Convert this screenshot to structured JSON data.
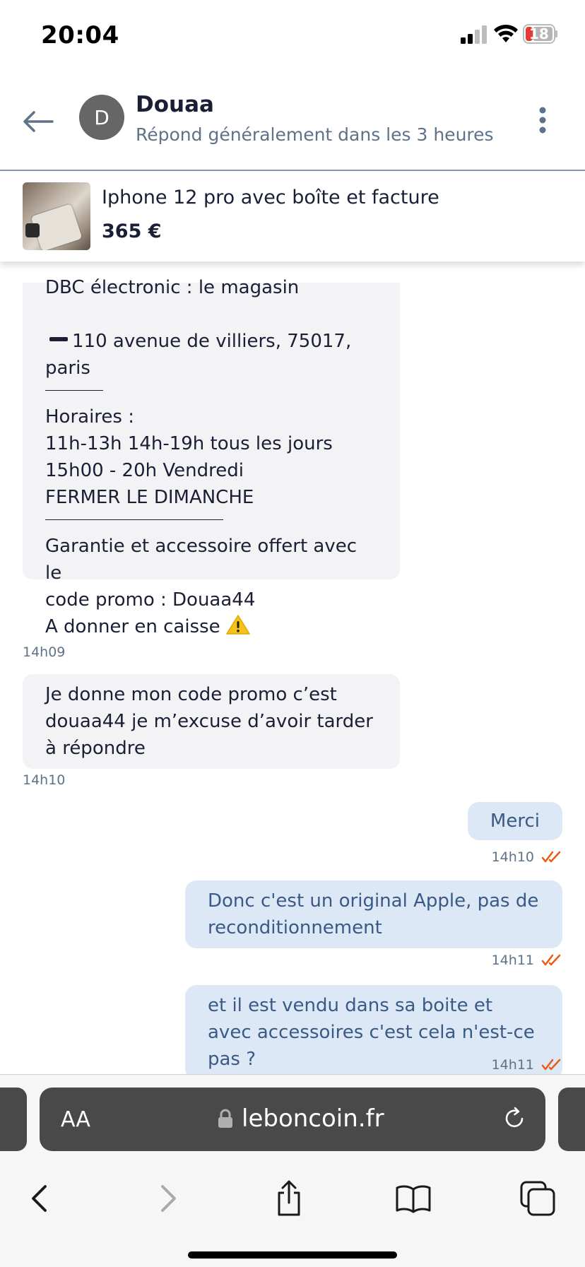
{
  "status_bar": {
    "time": "20:04",
    "battery": "18"
  },
  "header": {
    "avatar_initial": "D",
    "name": "Douaa",
    "subtitle": "Répond généralement dans les 3 heures"
  },
  "listing": {
    "title": "Iphone 12 pro avec boîte et facture",
    "price": "365 €"
  },
  "messages": {
    "m1": {
      "line1": "DBC électronic : le magasin",
      "line2": "110 avenue de villiers, 75017,",
      "line3": "paris",
      "line4": "Horaires :",
      "line5": "11h-13h 14h-19h tous les jours",
      "line6": "15h00 - 20h Vendredi",
      "line7": "FERMER LE DIMANCHE",
      "line8": "Garantie et accessoire offert avec le",
      "line9": "code promo : Douaa44",
      "line10": "A donner en caisse",
      "time": "14h09"
    },
    "m2": {
      "text": "Je donne mon code promo c’est douaa44 je m’excuse d’avoir tarder à répondre",
      "time": "14h10"
    },
    "m3": {
      "text": "Merci",
      "time": "14h10"
    },
    "m4": {
      "text": "Donc c'est un original Apple, pas de reconditionnement",
      "time": "14h11"
    },
    "m5": {
      "text": "et il est vendu dans sa boite et avec accessoires c'est cela n'est-ce pas ?",
      "time": "14h11"
    }
  },
  "browser": {
    "aa_label": "AA",
    "url": "leboncoin.fr"
  },
  "colors": {
    "accent": "#ec5a13",
    "outgoing_bubble": "#dde8f7",
    "incoming_bubble": "#f3f3f5",
    "url_bar": "#494949"
  }
}
